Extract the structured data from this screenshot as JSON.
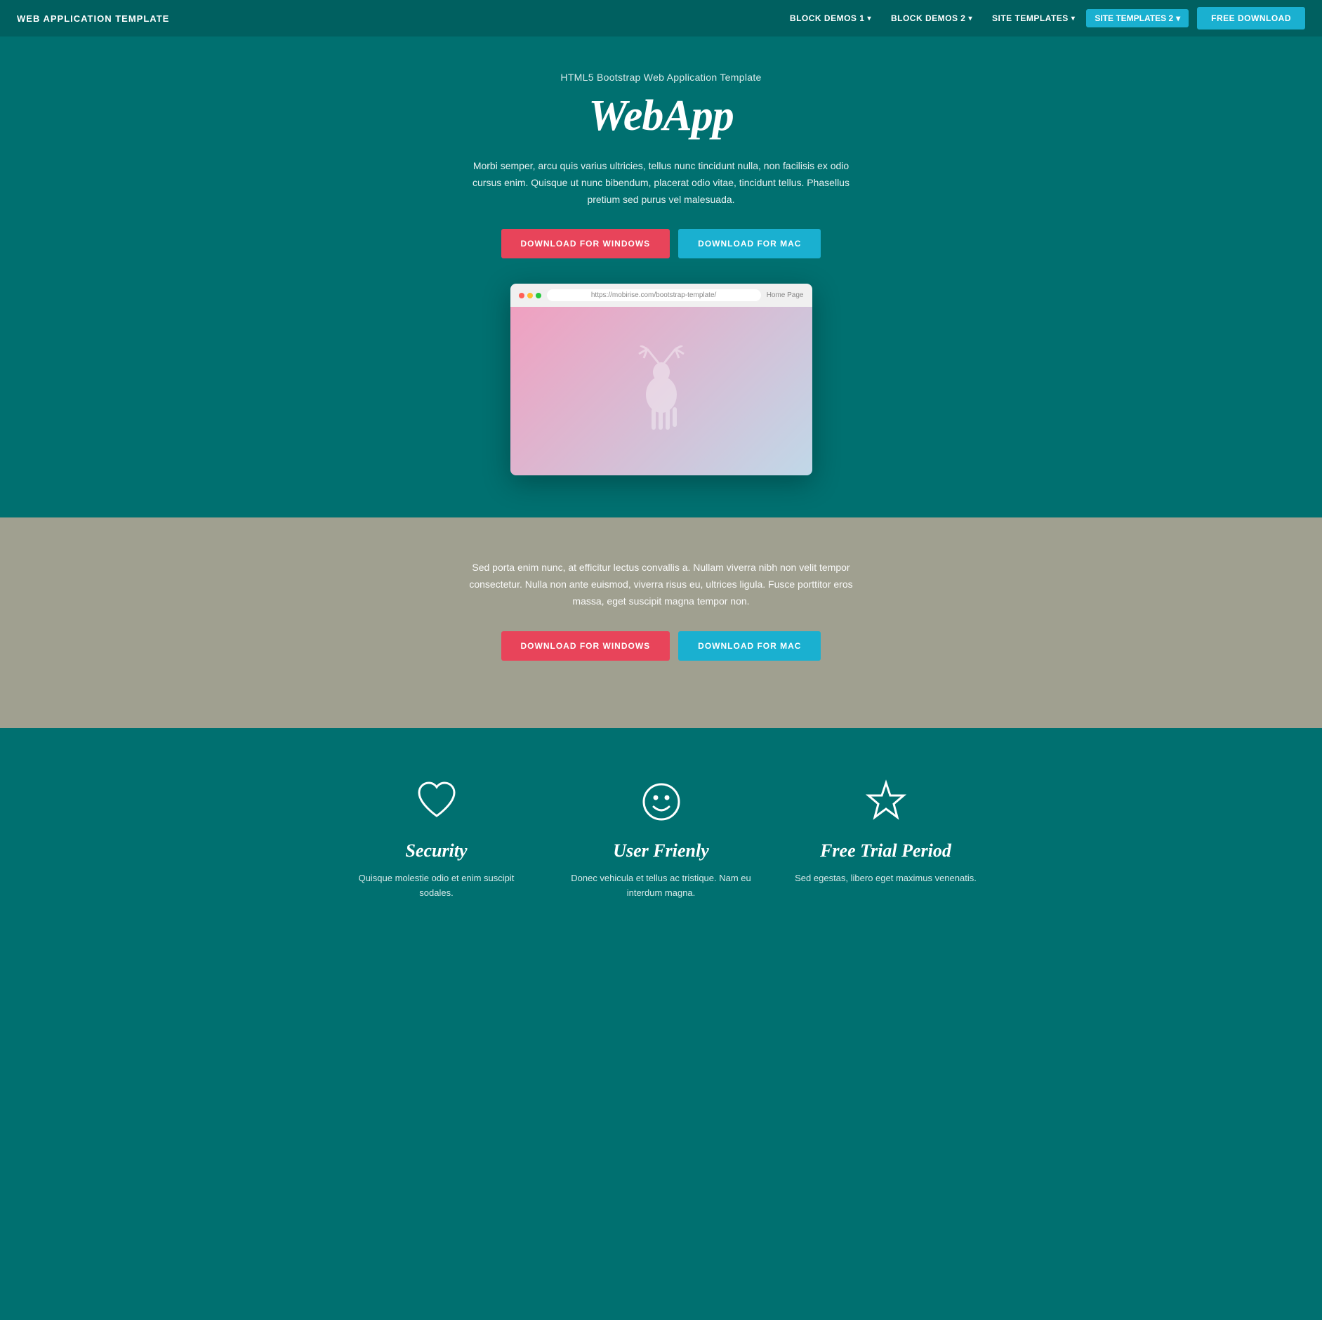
{
  "nav": {
    "brand": "WEB APPLICATION TEMPLATE",
    "links": [
      {
        "label": "BLOCK DEMOS 1",
        "has_dropdown": true
      },
      {
        "label": "BLOCK DEMOS 2",
        "has_dropdown": true
      },
      {
        "label": "SITE TEMPLATES",
        "has_dropdown": true
      }
    ],
    "active_link": "SITE TEMPLATES 2",
    "cta": "FREE DOWNLOAD"
  },
  "hero": {
    "subtitle": "HTML5 Bootstrap Web Application Template",
    "title": "WebApp",
    "description": "Morbi semper, arcu quis varius ultricies, tellus nunc tincidunt nulla, non facilisis ex odio cursus enim. Quisque ut nunc bibendum, placerat odio vitae, tincidunt tellus. Phasellus pretium sed purus vel malesuada.",
    "btn_windows": "DOWNLOAD FOR WINDOWS",
    "btn_mac": "DOWNLOAD FOR MAC",
    "browser_url": "https://mobirise.com/bootstrap-template/",
    "browser_home": "Home Page"
  },
  "grey_section": {
    "description": "Sed porta enim nunc, at efficitur lectus convallis a. Nullam viverra nibh non velit tempor consectetur. Nulla non ante euismod, viverra risus eu, ultrices ligula. Fusce porttitor eros massa, eget suscipit magna tempor non.",
    "btn_windows": "DOWNLOAD FOR WINDOWS",
    "btn_mac": "DOWNLOAD FOR MAC"
  },
  "features": {
    "items": [
      {
        "icon": "heart",
        "title": "Security",
        "description": "Quisque molestie odio et enim suscipit sodales."
      },
      {
        "icon": "smiley",
        "title": "User Frienly",
        "description": "Donec vehicula et tellus ac tristique. Nam eu interdum magna."
      },
      {
        "icon": "star",
        "title": "Free Trial Period",
        "description": "Sed egestas, libero eget maximus venenatis."
      }
    ]
  },
  "colors": {
    "bg_teal": "#007070",
    "bg_dark_teal": "#006060",
    "accent_blue": "#1ab0d0",
    "accent_red": "#e8445a",
    "bg_grey": "#a0a090"
  }
}
